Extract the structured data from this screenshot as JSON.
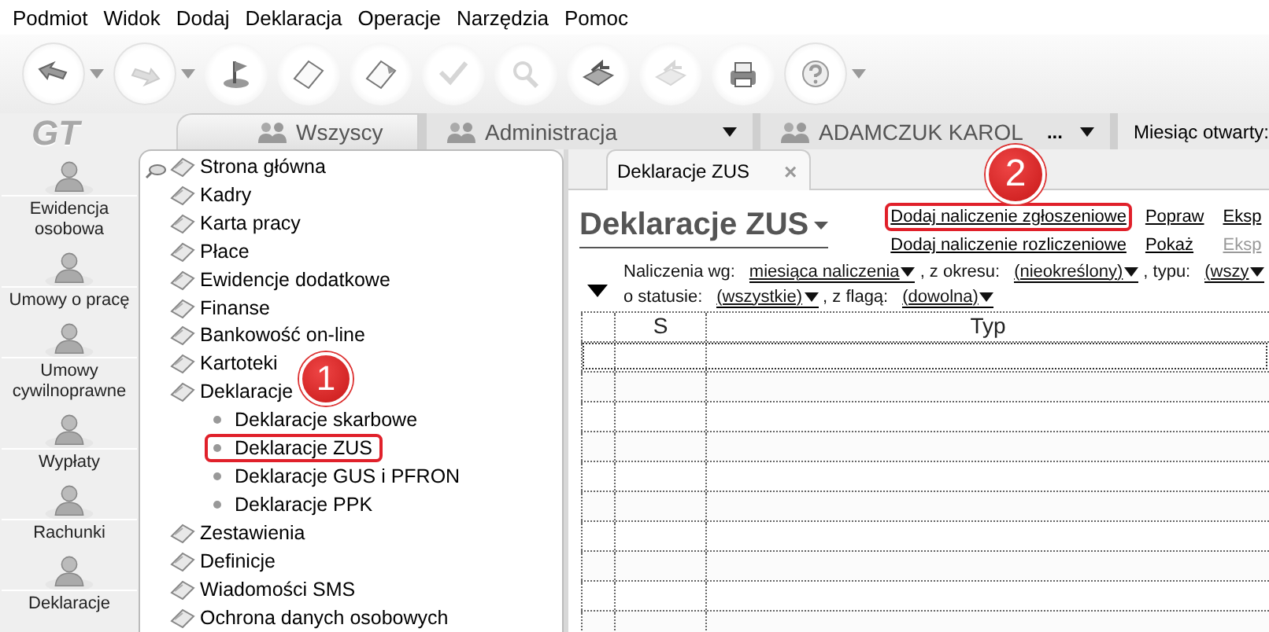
{
  "menu": [
    {
      "label": "Podmiot"
    },
    {
      "label": "Widok"
    },
    {
      "label": "Dodaj"
    },
    {
      "label": "Deklaracja"
    },
    {
      "label": "Operacje"
    },
    {
      "label": "Narzędzia"
    },
    {
      "label": "Pomoc"
    }
  ],
  "toolbar": [
    {
      "dropdown": true,
      "disabled": false
    },
    {
      "dropdown": true,
      "disabled": true
    },
    {
      "dropdown": false,
      "disabled": false
    },
    {
      "dropdown": false,
      "disabled": false
    },
    {
      "dropdown": false,
      "disabled": false
    },
    {
      "dropdown": false,
      "disabled": true
    },
    {
      "dropdown": false,
      "disabled": true
    },
    {
      "dropdown": false,
      "disabled": false
    },
    {
      "dropdown": false,
      "disabled": true
    },
    {
      "dropdown": false,
      "disabled": false
    },
    {
      "dropdown": true,
      "disabled": false
    }
  ],
  "logo": "GT",
  "sidebar": {
    "items": [
      {
        "label": "Ewidencja osobowa"
      },
      {
        "label": "Umowy o pracę"
      },
      {
        "label": "Umowy cywilnoprawne"
      },
      {
        "label": "Wypłaty"
      },
      {
        "label": "Rachunki"
      },
      {
        "label": "Deklaracje"
      }
    ]
  },
  "context_tabs": [
    {
      "label": "Wszyscy",
      "selected": true,
      "dropdown": false
    },
    {
      "label": "Administracja",
      "selected": false,
      "dropdown": true
    },
    {
      "label": "ADAMCZUK KAROL",
      "selected": false,
      "more": "...",
      "dropdown": true
    }
  ],
  "open_month_label": "Miesiąc otwarty:",
  "tree": [
    {
      "label": "Strona główna"
    },
    {
      "label": "Kadry"
    },
    {
      "label": "Karta pracy"
    },
    {
      "label": "Płace"
    },
    {
      "label": "Ewidencje dodatkowe"
    },
    {
      "label": "Finanse"
    },
    {
      "label": "Bankowość on-line"
    },
    {
      "label": "Kartoteki"
    },
    {
      "label": "Deklaracje",
      "children": [
        {
          "label": "Deklaracje skarbowe",
          "highlighted": false
        },
        {
          "label": "Deklaracje ZUS",
          "highlighted": true
        },
        {
          "label": "Deklaracje GUS i PFRON",
          "highlighted": false
        },
        {
          "label": "Deklaracje PPK",
          "highlighted": false
        }
      ]
    },
    {
      "label": "Zestawienia"
    },
    {
      "label": "Definicje"
    },
    {
      "label": "Wiadomości SMS"
    },
    {
      "label": "Ochrona danych osobowych"
    }
  ],
  "document_tabs": [
    {
      "label": "Deklaracje ZUS",
      "selected": true,
      "close": "×"
    }
  ],
  "page": {
    "title": "Deklaracje ZUS",
    "actions": [
      [
        {
          "label": "Dodaj naliczenie zgłoszeniowe",
          "disabled": false,
          "highlighted": true
        },
        {
          "label": "Dodaj naliczenie rozliczeniowe",
          "disabled": false,
          "highlighted": false
        }
      ],
      [
        {
          "label": "Popraw",
          "disabled": false,
          "highlighted": false
        },
        {
          "label": "Pokaż",
          "disabled": false,
          "highlighted": false
        }
      ],
      [
        {
          "label": "Eksp",
          "disabled": false,
          "highlighted": false
        },
        {
          "label": "Eksp",
          "disabled": true,
          "highlighted": false
        }
      ]
    ],
    "filters": [
      [
        {
          "kind": "label",
          "text": "Naliczenia wg:"
        },
        {
          "kind": "choice",
          "text": "miesiąca naliczenia"
        },
        {
          "kind": "label",
          "text": ", z okresu:"
        },
        {
          "kind": "choice",
          "text": "(nieokreślony)"
        },
        {
          "kind": "label",
          "text": ", typu:"
        },
        {
          "kind": "choice",
          "text": "(wszy"
        }
      ],
      [
        {
          "kind": "label",
          "text": "o statusie:"
        },
        {
          "kind": "choice",
          "text": "(wszystkie)"
        },
        {
          "kind": "label",
          "text": ", z flagą:"
        },
        {
          "kind": "choice",
          "text": "(dowolna)"
        }
      ]
    ]
  },
  "table": {
    "columns": [
      {
        "label": "S"
      },
      {
        "label": "Typ"
      }
    ]
  },
  "callouts": [
    {
      "label": "1"
    },
    {
      "label": "2"
    }
  ]
}
